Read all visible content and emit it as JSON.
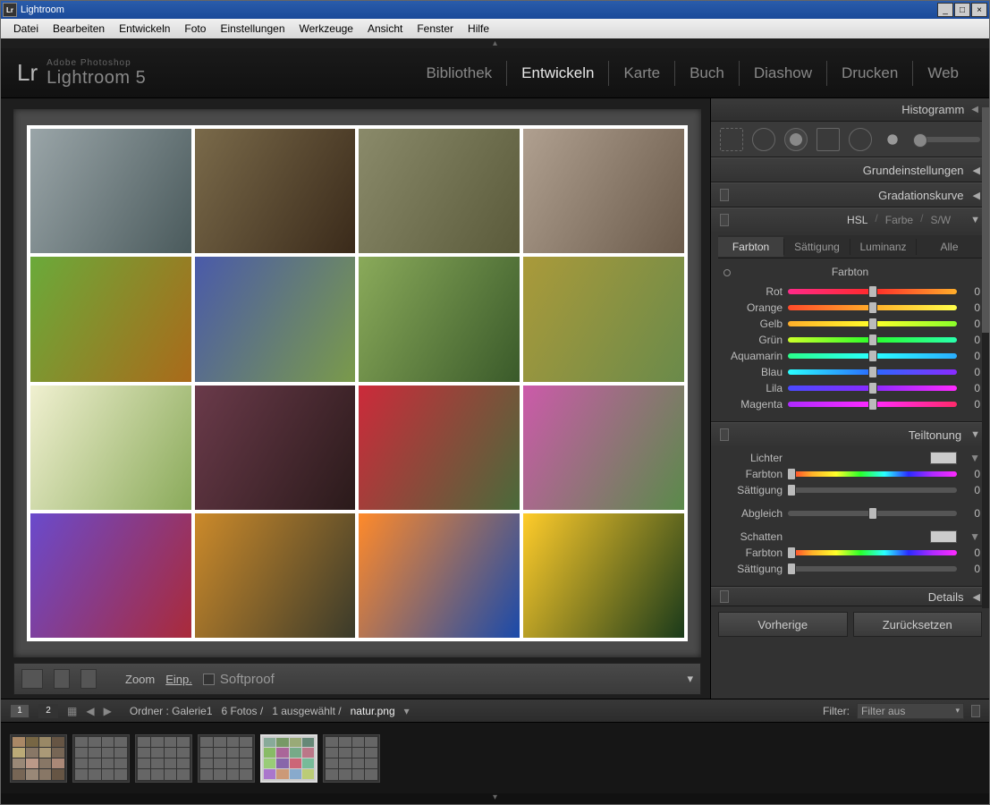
{
  "window": {
    "title": "Lightroom"
  },
  "menu": {
    "items": [
      "Datei",
      "Bearbeiten",
      "Entwickeln",
      "Foto",
      "Einstellungen",
      "Werkzeuge",
      "Ansicht",
      "Fenster",
      "Hilfe"
    ]
  },
  "brand": {
    "logo": "Lr",
    "sub": "Adobe Photoshop",
    "main": "Lightroom 5"
  },
  "modules": {
    "items": [
      "Bibliothek",
      "Entwickeln",
      "Karte",
      "Buch",
      "Diashow",
      "Drucken",
      "Web"
    ],
    "active": "Entwickeln"
  },
  "toolbar": {
    "zoom": "Zoom",
    "einp": "Einp.",
    "softproof": "Softproof"
  },
  "right": {
    "histogram": "Histogramm",
    "basic": "Grundeinstellungen",
    "tonecurve": "Gradationskurve",
    "hsl": {
      "hsl": "HSL",
      "farbe": "Farbe",
      "sw": "S/W"
    },
    "subtabs": {
      "farbton": "Farbton",
      "saettigung": "Sättigung",
      "luminanz": "Luminanz",
      "alle": "Alle"
    },
    "hue_title": "Farbton",
    "hues": [
      {
        "label": "Rot",
        "value": "0"
      },
      {
        "label": "Orange",
        "value": "0"
      },
      {
        "label": "Gelb",
        "value": "0"
      },
      {
        "label": "Grün",
        "value": "0"
      },
      {
        "label": "Aquamarin",
        "value": "0"
      },
      {
        "label": "Blau",
        "value": "0"
      },
      {
        "label": "Lila",
        "value": "0"
      },
      {
        "label": "Magenta",
        "value": "0"
      }
    ],
    "split": {
      "title": "Teiltonung",
      "lichter": "Lichter",
      "farbton": "Farbton",
      "saettigung": "Sättigung",
      "abgleich": "Abgleich",
      "schatten": "Schatten",
      "val0": "0"
    },
    "details": "Details",
    "prev": "Vorherige",
    "reset": "Zurücksetzen"
  },
  "filmbar": {
    "screen1": "1",
    "screen2": "2",
    "folder": "Ordner : Galerie1",
    "count": "6 Fotos /",
    "selected": "1 ausgewählt /",
    "filename": "natur.png",
    "filter_label": "Filter:",
    "filter_value": "Filter aus"
  }
}
